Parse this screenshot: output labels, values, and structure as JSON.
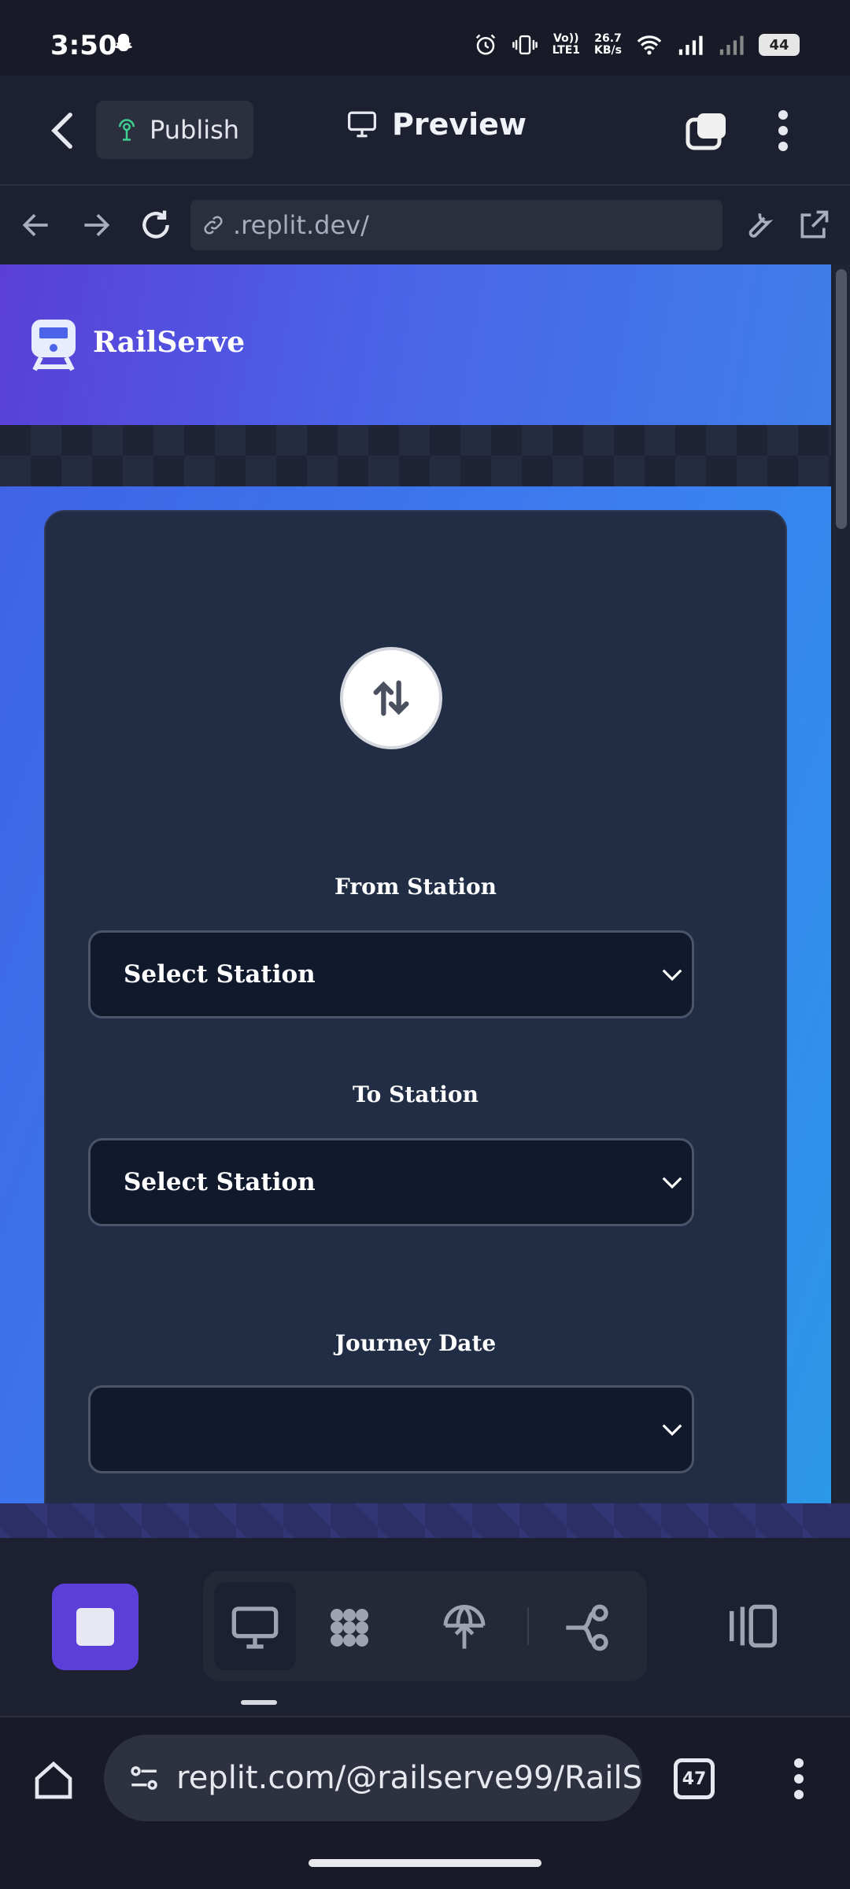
{
  "status_bar": {
    "time": "3:50",
    "net_speed_value": "26.7",
    "net_speed_unit": "KB/s",
    "volte": "Vo))",
    "lte": "LTE1",
    "battery": "44"
  },
  "topbar": {
    "publish_label": "Publish",
    "preview_label": "Preview"
  },
  "urlbar": {
    "url": ".replit.dev/"
  },
  "app": {
    "brand": "RailServe",
    "form": {
      "from_label": "From Station",
      "from_value": "Select Station",
      "to_label": "To Station",
      "to_value": "Select Station",
      "date_label": "Journey Date",
      "date_value": ""
    }
  },
  "chrome": {
    "omnibox_url": "replit.com/@railserve99/RailS",
    "tab_count": "47"
  },
  "colors": {
    "brand_gradient_start": "#5a3fd6",
    "brand_gradient_end": "#3f7ee8",
    "card_bg": "#212d45",
    "stop_button": "#5c3fd8"
  }
}
